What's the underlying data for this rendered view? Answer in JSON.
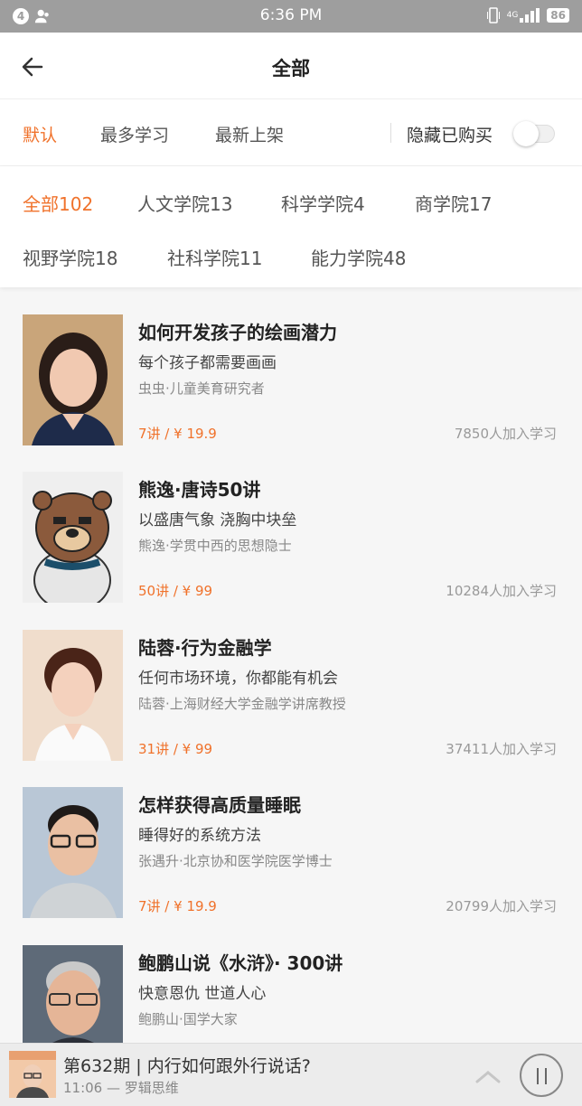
{
  "status": {
    "notif_count": "4",
    "time": "6:36 PM",
    "network": "4G",
    "battery": "86"
  },
  "header": {
    "title": "全部"
  },
  "sort": {
    "default": "默认",
    "most_studied": "最多学习",
    "newest": "最新上架",
    "hide_purchased": "隐藏已购买",
    "hide_purchased_on": false
  },
  "categories": [
    "全部102",
    "人文学院13",
    "科学学院4",
    "商学院17",
    "视野学院18",
    "社科学院11",
    "能力学院48"
  ],
  "courses": [
    {
      "title": "如何开发孩子的绘画潜力",
      "subtitle": "每个孩子都需要画画",
      "author": "虫虫·儿童美育研究者",
      "price": "7讲 / ¥ 19.9",
      "learners": "7850人加入学习"
    },
    {
      "title": "熊逸·唐诗50讲",
      "subtitle": "以盛唐气象 浇胸中块垒",
      "author": "熊逸·学贯中西的思想隐士",
      "price": "50讲 / ¥ 99",
      "learners": "10284人加入学习"
    },
    {
      "title": "陆蓉·行为金融学",
      "subtitle": "任何市场环境，你都能有机会",
      "author": "陆蓉·上海财经大学金融学讲席教授",
      "price": "31讲 / ¥ 99",
      "learners": "37411人加入学习"
    },
    {
      "title": "怎样获得高质量睡眠",
      "subtitle": "睡得好的系统方法",
      "author": "张遇升·北京协和医学院医学博士",
      "price": "7讲 / ¥ 19.9",
      "learners": "20799人加入学习"
    },
    {
      "title": "鲍鹏山说《水浒》· 300讲",
      "subtitle": "快意恩仇 世道人心",
      "author": "鲍鹏山·国学大家",
      "price": "",
      "learners": ""
    }
  ],
  "player": {
    "title": "第632期 | 内行如何跟外行说话?",
    "meta": "11:06   — 罗辑思维"
  },
  "colors": {
    "accent": "#f0722b",
    "statusbar": "#9e9e9e"
  }
}
